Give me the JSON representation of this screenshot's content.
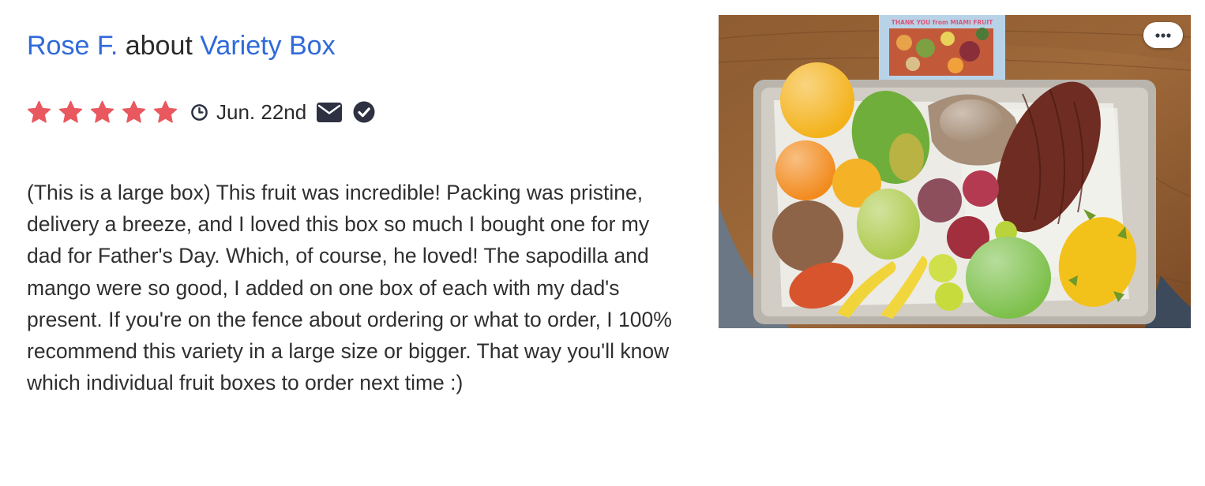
{
  "review": {
    "author": "Rose F.",
    "about_word": "about",
    "product": "Variety Box",
    "rating": 5,
    "rating_max": 5,
    "date": "Jun. 22nd",
    "text": "(This is a large box) This fruit was incredible! Packing was pristine, delivery a breeze, and I loved this box so much I bought one for my dad for Father's Day. Which, of course, he loved! The sapodilla and mango were so good, I added on one box of each with my dad's present. If you're on the fence about ordering or what to order, I 100% recommend this variety in a large size or bigger. That way you'll know which individual fruit boxes to order next time :)"
  },
  "icons": {
    "rating": "star-icon",
    "date": "clock-icon",
    "contact": "envelope-icon",
    "verified": "check-circle-icon",
    "menu": "more-dots-icon"
  },
  "photo": {
    "card_text": "THANK YOU from MIAMI FRUIT"
  },
  "colors": {
    "link": "#2f6ad9",
    "star": "#e8585e",
    "text": "#2b2b2b",
    "icon": "#2d3142"
  }
}
